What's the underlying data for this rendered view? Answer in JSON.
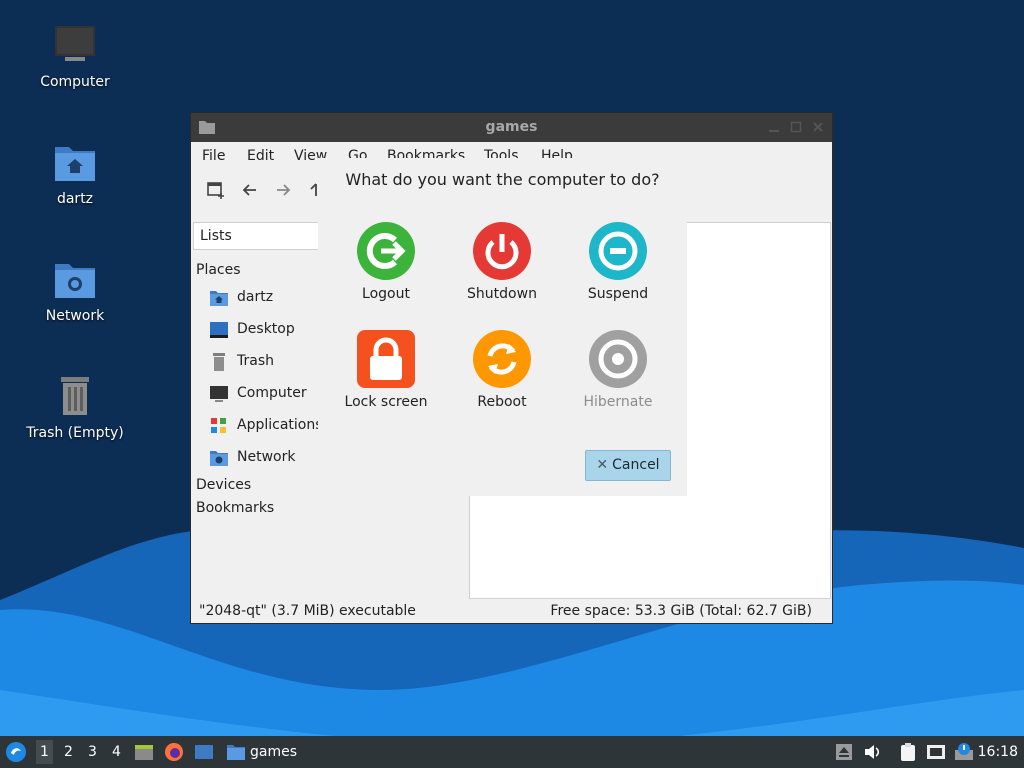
{
  "desktop": {
    "icons": [
      {
        "label": "Computer"
      },
      {
        "label": "dartz"
      },
      {
        "label": "Network"
      },
      {
        "label": "Trash (Empty)"
      }
    ]
  },
  "window": {
    "title": "games",
    "menu": [
      "File",
      "Edit",
      "View",
      "Go",
      "Bookmarks",
      "Tools",
      "Help"
    ],
    "side_combo": "Lists",
    "places_header": "Places",
    "places": [
      {
        "label": "dartz",
        "icon": "home-folder-icon"
      },
      {
        "label": "Desktop",
        "icon": "desktop-icon"
      },
      {
        "label": "Trash",
        "icon": "trash-icon"
      },
      {
        "label": "Computer",
        "icon": "computer-icon"
      },
      {
        "label": "Applications",
        "icon": "applications-icon"
      },
      {
        "label": "Network",
        "icon": "network-folder-icon"
      }
    ],
    "devices_header": "Devices",
    "bookmarks_header": "Bookmarks",
    "status_left": "\"2048-qt\" (3.7 MiB) executable",
    "status_right": "Free space: 53.3 GiB (Total: 62.7 GiB)"
  },
  "dialog": {
    "question": "What do you want the computer to do?",
    "actions": [
      {
        "label": "Logout",
        "icon": "logout-icon",
        "color": "#3cb43c",
        "enabled": true
      },
      {
        "label": "Shutdown",
        "icon": "power-icon",
        "color": "#e53935",
        "enabled": true
      },
      {
        "label": "Suspend",
        "icon": "suspend-icon",
        "color": "#1eb6c9",
        "enabled": true
      },
      {
        "label": "Lock screen",
        "icon": "lock-icon",
        "color": "#f4511e",
        "enabled": true
      },
      {
        "label": "Reboot",
        "icon": "reboot-icon",
        "color": "#ff9800",
        "enabled": true
      },
      {
        "label": "Hibernate",
        "icon": "hibernate-icon",
        "color": "#a0a0a0",
        "enabled": false
      }
    ],
    "cancel_label": "Cancel"
  },
  "taskbar": {
    "workspaces": [
      "1",
      "2",
      "3",
      "4"
    ],
    "active_workspace": "1",
    "task_label": "games",
    "clock": "16:18"
  }
}
